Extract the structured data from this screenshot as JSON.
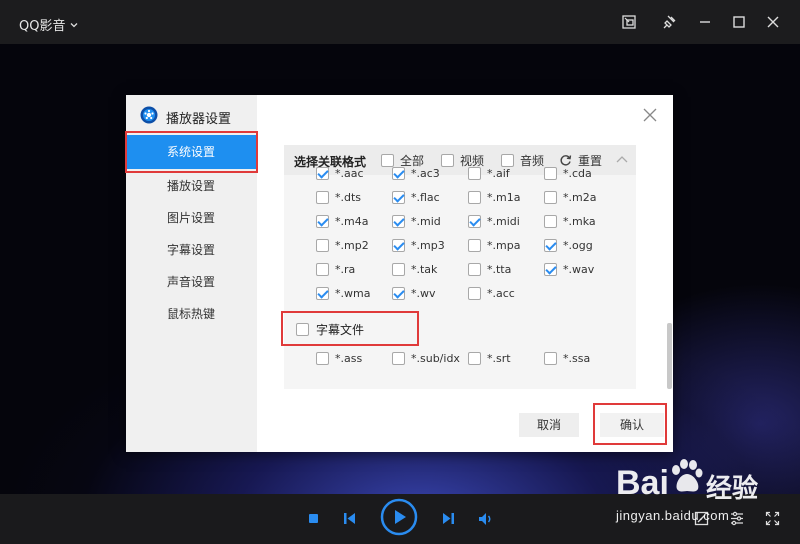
{
  "app": {
    "title": "QQ影音"
  },
  "dialog": {
    "title": "播放器设置",
    "nav": [
      {
        "label": "系统设置",
        "active": true
      },
      {
        "label": "播放设置",
        "active": false
      },
      {
        "label": "图片设置",
        "active": false
      },
      {
        "label": "字幕设置",
        "active": false
      },
      {
        "label": "声音设置",
        "active": false
      },
      {
        "label": "鼠标热键",
        "active": false
      }
    ],
    "assoc": {
      "heading": "选择关联格式",
      "options": [
        {
          "label": "全部",
          "checked": false
        },
        {
          "label": "视频",
          "checked": false
        },
        {
          "label": "音频",
          "checked": false
        }
      ],
      "reset_label": "重置"
    },
    "formats": [
      {
        "label": "*.aac",
        "checked": true
      },
      {
        "label": "*.ac3",
        "checked": true
      },
      {
        "label": "*.aif",
        "checked": false
      },
      {
        "label": "*.cda",
        "checked": false
      },
      {
        "label": "*.dts",
        "checked": false
      },
      {
        "label": "*.flac",
        "checked": true
      },
      {
        "label": "*.m1a",
        "checked": false
      },
      {
        "label": "*.m2a",
        "checked": false
      },
      {
        "label": "*.m4a",
        "checked": true
      },
      {
        "label": "*.mid",
        "checked": true
      },
      {
        "label": "*.midi",
        "checked": true
      },
      {
        "label": "*.mka",
        "checked": false
      },
      {
        "label": "*.mp2",
        "checked": false
      },
      {
        "label": "*.mp3",
        "checked": true
      },
      {
        "label": "*.mpa",
        "checked": false
      },
      {
        "label": "*.ogg",
        "checked": true
      },
      {
        "label": "*.ra",
        "checked": false
      },
      {
        "label": "*.tak",
        "checked": false
      },
      {
        "label": "*.tta",
        "checked": false
      },
      {
        "label": "*.wav",
        "checked": true
      },
      {
        "label": "*.wma",
        "checked": true
      },
      {
        "label": "*.wv",
        "checked": true
      },
      {
        "label": "*.acc",
        "checked": false
      }
    ],
    "subtitle_section": {
      "label": "字幕文件",
      "checked": false,
      "formats": [
        {
          "label": "*.ass",
          "checked": false
        },
        {
          "label": "*.sub/idx",
          "checked": false
        },
        {
          "label": "*.srt",
          "checked": false
        },
        {
          "label": "*.ssa",
          "checked": false
        }
      ]
    },
    "buttons": {
      "cancel": "取消",
      "confirm": "确认"
    }
  },
  "watermark": {
    "brand": "Bai du 经验",
    "url": "jingyan.baidu.com"
  },
  "colors": {
    "accent": "#1e8ff0",
    "highlight_box": "#e03a3a",
    "titlebar": "#1c1c1e",
    "play_button": "#2a8cf0"
  }
}
